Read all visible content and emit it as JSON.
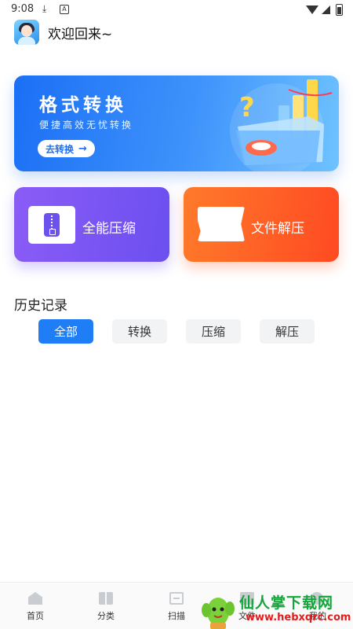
{
  "status_bar": {
    "time": "9:08",
    "icons": [
      "download-icon",
      "a-icon",
      "wifi-icon",
      "signal-icon",
      "battery-icon"
    ]
  },
  "header": {
    "welcome_text": "欢迎回来~"
  },
  "banner": {
    "title": "格式转换",
    "subtitle": "便捷高效无忧转换",
    "button_label": "去转换",
    "button_arrow": "→"
  },
  "cards": [
    {
      "label": "全能压缩",
      "icon": "zip-icon",
      "color": "#7c56f3"
    },
    {
      "label": "文件解压",
      "icon": "extract-icon",
      "color": "#ff5a26"
    }
  ],
  "history": {
    "title": "历史记录",
    "tabs": [
      "全部",
      "转换",
      "压缩",
      "解压"
    ],
    "active_tab": "全部"
  },
  "bottom_nav": [
    {
      "label": "首页",
      "icon": "home-icon"
    },
    {
      "label": "分类",
      "icon": "category-icon"
    },
    {
      "label": "扫描",
      "icon": "scan-icon"
    },
    {
      "label": "文件",
      "icon": "file-icon"
    },
    {
      "label": "我的",
      "icon": "mine-icon"
    }
  ],
  "watermark": {
    "name": "仙人掌下载网",
    "url": "www.hebxqrc.com"
  },
  "colors": {
    "accent": "#1f7ef5",
    "banner_start": "#1b6ff5",
    "compress_card": "#7c56f3",
    "extract_card": "#ff5a26"
  }
}
